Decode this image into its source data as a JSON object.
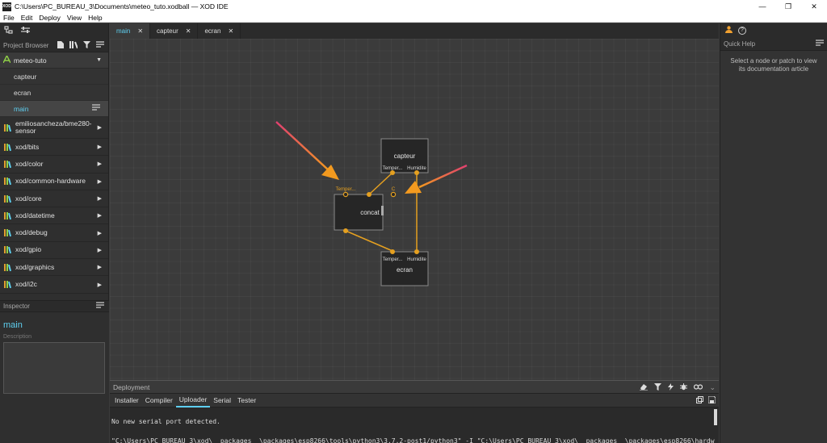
{
  "window": {
    "app_icon_text": "XOD",
    "title": "C:\\Users\\PC_BUREAU_3\\Documents\\meteo_tuto.xodball — XOD IDE",
    "minimize": "—",
    "maximize": "❐",
    "close": "✕"
  },
  "menu": [
    "File",
    "Edit",
    "Deploy",
    "View",
    "Help"
  ],
  "project_browser": {
    "title": "Project Browser",
    "project_name": "meteo-tuto",
    "patches": [
      "capteur",
      "ecran",
      "main"
    ],
    "selected_patch": "main",
    "libraries": [
      "emiliosancheza/bme280-sensor",
      "xod/bits",
      "xod/color",
      "xod/common-hardware",
      "xod/core",
      "xod/datetime",
      "xod/debug",
      "xod/gpio",
      "xod/graphics",
      "xod/i2c"
    ]
  },
  "inspector": {
    "title": "Inspector",
    "patch_name": "main",
    "description_label": "Description"
  },
  "editor_tabs": [
    {
      "label": "main",
      "active": true
    },
    {
      "label": "capteur",
      "active": false
    },
    {
      "label": "ecran",
      "active": false
    }
  ],
  "nodes": {
    "capteur": {
      "label": "capteur",
      "pin_temp": "Temper...",
      "pin_hum": "Humidite"
    },
    "concat": {
      "label": "concat",
      "pin_a": "Temper...",
      "pin_b": "C"
    },
    "ecran": {
      "label": "ecran",
      "pin_temp": "Temper...",
      "pin_hum": "Humidite"
    }
  },
  "quick_help": {
    "title": "Quick Help",
    "text_line1": "Select a node or patch to view",
    "text_line2": "its documentation article"
  },
  "deployment": {
    "title": "Deployment",
    "tabs": [
      "Installer",
      "Compiler",
      "Uploader",
      "Serial",
      "Tester"
    ],
    "active_tab": "Uploader",
    "console_lines": [
      "",
      "No new serial port detected.",
      "",
      "\"C:\\Users\\PC_BUREAU_3\\xod\\__packages__\\packages\\esp8266\\tools\\python3\\3.7.2-post1/python3\" -I \"C:\\Users\\PC_BUREAU_3\\xod\\__packages__\\packages\\esp8266\\hardw"
    ]
  },
  "colors": {
    "accent_blue": "#5ecff0",
    "link_orange": "#e5a020",
    "annotation_arrow": "#f39a1f",
    "annotation_tail": "#e04070"
  },
  "icons": {
    "left_tab_1": "project-browser-icon",
    "left_tab_2": "settings-sliders-icon",
    "right_tab_1": "user-icon",
    "right_tab_2": "help-icon"
  }
}
